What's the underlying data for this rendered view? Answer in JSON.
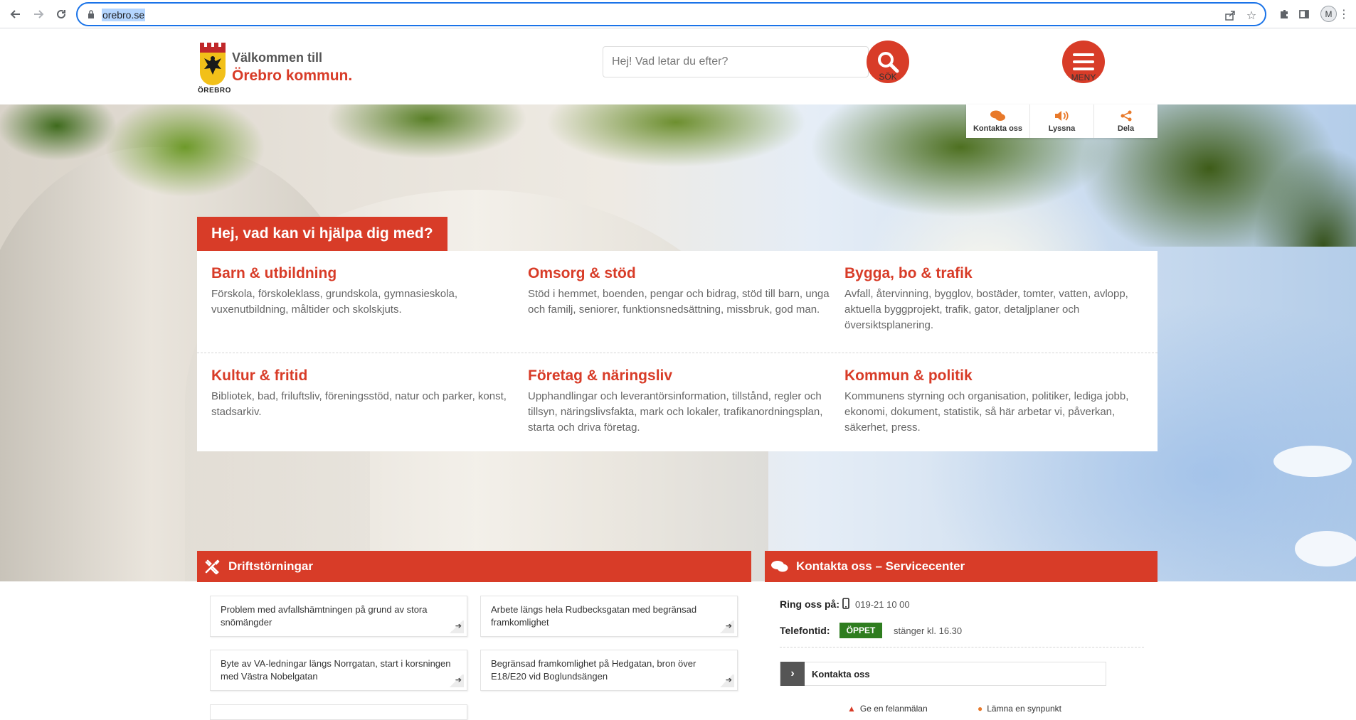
{
  "browser": {
    "url": "orebro.se",
    "avatar_letter": "M"
  },
  "header": {
    "logo_caption": "ÖREBRO",
    "welcome_line1": "Välkommen till",
    "welcome_line2": "Örebro kommun.",
    "search_placeholder": "Hej! Vad letar du efter?",
    "search_label": "SÖK",
    "menu_label": "MENY"
  },
  "sharebar": {
    "contact": "Kontakta oss",
    "listen": "Lyssna",
    "share": "Dela"
  },
  "help": {
    "title": "Hej, vad kan vi hjälpa dig med?",
    "categories": [
      {
        "title": "Barn & utbildning",
        "desc": "Förskola, förskoleklass, grundskola, gymnasieskola, vuxenutbildning, måltider och skolskjuts."
      },
      {
        "title": "Omsorg & stöd",
        "desc": "Stöd i hemmet, boenden, pengar och bidrag, stöd till barn, unga och familj, seniorer, funktionsnedsättning, missbruk, god man."
      },
      {
        "title": "Bygga, bo & trafik",
        "desc": "Avfall, återvinning, bygglov, bostäder, tomter, vatten, avlopp, aktuella byggprojekt, trafik, gator, detaljplaner och översiktsplanering."
      },
      {
        "title": "Kultur & fritid",
        "desc": "Bibliotek, bad, friluftsliv, föreningsstöd, natur och parker, konst, stadsarkiv."
      },
      {
        "title": "Företag & näringsliv",
        "desc": "Upphandlingar och leverantörsinformation, tillstånd, regler och tillsyn, näringslivsfakta, mark och lokaler, trafikanordningsplan, starta och driva företag."
      },
      {
        "title": "Kommun & politik",
        "desc": "Kommunens styrning och organisation, politiker, lediga jobb, ekonomi, dokument, statistik, så här arbetar vi, påverkan, säkerhet, press."
      }
    ]
  },
  "disruptions": {
    "title": "Driftstörningar",
    "items": [
      "Problem med avfallshämtningen på grund av stora snömängder",
      "Arbete längs hela Rudbecksgatan med begränsad framkomlighet",
      "Byte av VA-ledningar längs Norrgatan, start i korsningen med Västra Nobelgatan",
      "Begränsad framkomlighet på Hedgatan, bron över E18/E20 vid Boglundsängen"
    ]
  },
  "contact": {
    "title": "Kontakta oss – Servicecenter",
    "phone_label": "Ring oss på:",
    "phone": "019-21 10 00",
    "hours_label": "Telefontid:",
    "status": "ÖPPET",
    "closes": "stänger kl. 16.30",
    "link": "Kontakta oss",
    "mini_links": [
      "Ge en felanmälan",
      "Lämna en synpunkt"
    ]
  },
  "colors": {
    "brand": "#d83c28",
    "open": "#2e7d1f",
    "share_icon": "#e8792a"
  }
}
